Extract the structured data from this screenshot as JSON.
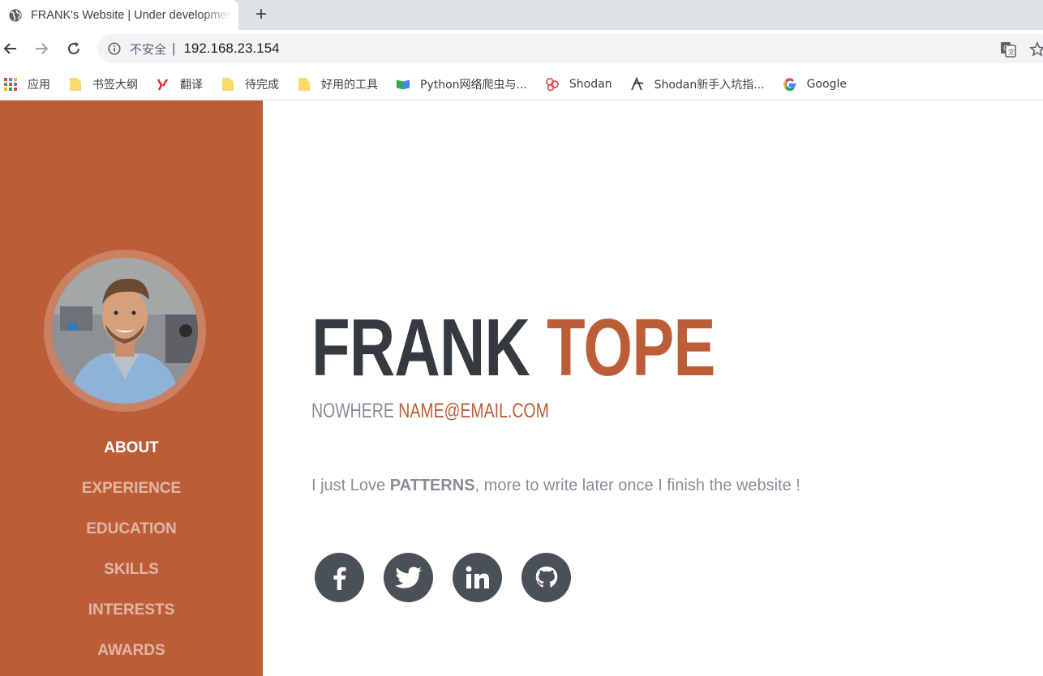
{
  "browser": {
    "tab_title": "FRANK's Website | Under development",
    "new_tab_symbol": "+",
    "security_label": "不安全",
    "separator": "|",
    "url": "192.168.23.154",
    "icons": [
      "globe-icon",
      "back-arrow-icon",
      "forward-arrow-icon",
      "reload-icon",
      "info-icon",
      "translate-icon",
      "star-icon"
    ]
  },
  "bookmarks": [
    {
      "label": "应用",
      "icon": "apps-grid-icon"
    },
    {
      "label": "书签大纲",
      "icon": "folder-icon"
    },
    {
      "label": "翻译",
      "icon": "youdao-icon"
    },
    {
      "label": "待完成",
      "icon": "folder-icon"
    },
    {
      "label": "好用的工具",
      "icon": "folder-icon"
    },
    {
      "label": "Python网络爬虫与...",
      "icon": "book-icon"
    },
    {
      "label": "Shodan",
      "icon": "shodan-icon"
    },
    {
      "label": "Shodan新手入坑指...",
      "icon": "shodan-guide-icon"
    },
    {
      "label": "Google",
      "icon": "google-icon"
    }
  ],
  "sidebar": {
    "nav": [
      {
        "label": "ABOUT",
        "active": true
      },
      {
        "label": "EXPERIENCE",
        "active": false
      },
      {
        "label": "EDUCATION",
        "active": false
      },
      {
        "label": "SKILLS",
        "active": false
      },
      {
        "label": "INTERESTS",
        "active": false
      },
      {
        "label": "AWARDS",
        "active": false
      }
    ]
  },
  "about": {
    "first_name": "FRANK",
    "last_name": "TOPE",
    "address": "NOWHERE",
    "email": "NAME@EMAIL.COM",
    "lead_before": "I just Love ",
    "lead_bold": "PATTERNS",
    "lead_after": ", more to write later once I finish the website !",
    "social": [
      "facebook-icon",
      "twitter-icon",
      "linkedin-icon",
      "github-icon"
    ]
  },
  "colors": {
    "primary": "#bd5d38",
    "dark": "#343a40",
    "muted": "#868e96",
    "social_bg": "#495057"
  }
}
